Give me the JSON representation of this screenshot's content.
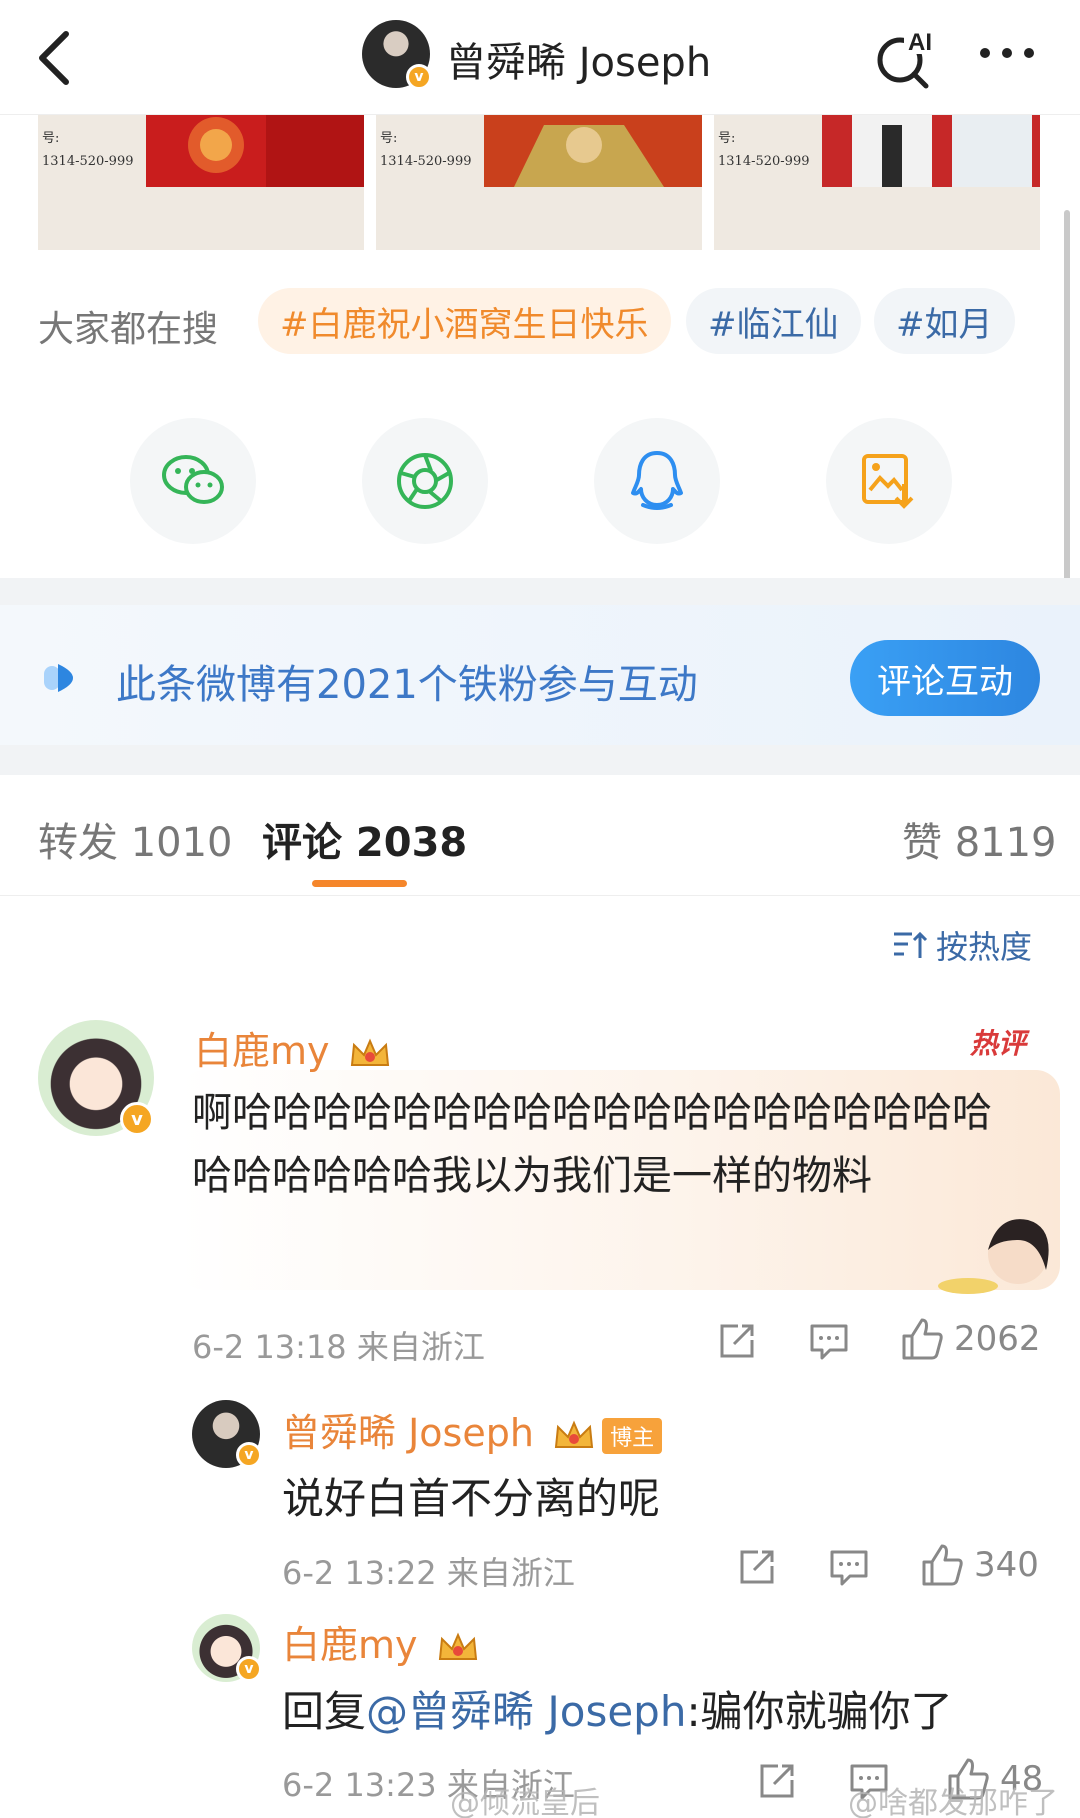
{
  "header": {
    "title": "曾舜晞 Joseph",
    "ai_label": "AI"
  },
  "posters": [
    {
      "label": "号:\n1314-520-999"
    },
    {
      "label": "号:\n1314-520-999"
    },
    {
      "label": "号:\n1314-520-999"
    }
  ],
  "trending": {
    "label": "大家都在搜",
    "chips": [
      "#白鹿祝小酒窝生日快乐",
      "#临江仙",
      "#如月"
    ]
  },
  "share": [
    "wechat-icon",
    "moments-icon",
    "qq-icon",
    "save-image-icon"
  ],
  "banner": {
    "text": "此条微博有2021个铁粉参与互动",
    "button": "评论互动"
  },
  "tabs": {
    "repost": "转发 1010",
    "comment": "评论 2038",
    "like": "赞 8119"
  },
  "sort": {
    "label": "按热度"
  },
  "comments": [
    {
      "user": "白鹿my",
      "badge": "热评",
      "text": "啊哈哈哈哈哈哈哈哈哈哈哈哈哈哈哈哈哈哈哈哈哈哈哈哈哈我以为我们是一样的物料",
      "meta": "6-2 13:18 来自浙江",
      "likes": "2062"
    }
  ],
  "replies": [
    {
      "user": "曾舜晞 Joseph",
      "tag": "博主",
      "text": "说好白首不分离的呢",
      "meta": "6-2 13:22 来自浙江",
      "likes": "340"
    },
    {
      "user": "白鹿my",
      "prefix": "回复",
      "mention": "@曾舜晞 Joseph",
      "text": ":骗你就骗你了",
      "meta": "6-2 13:23 来自浙江",
      "likes": "48"
    }
  ],
  "watermarks": [
    "@倾流皇后",
    "@啥都发那咋了"
  ]
}
